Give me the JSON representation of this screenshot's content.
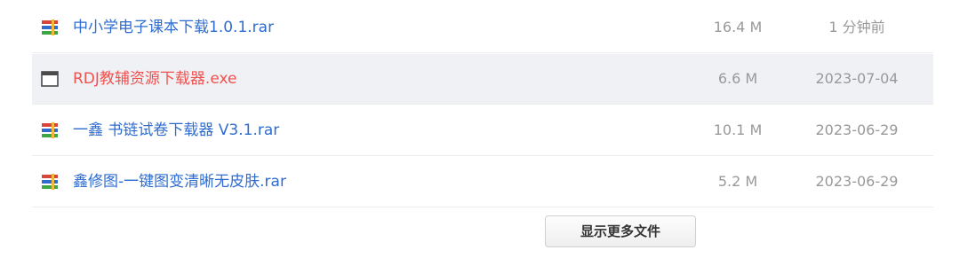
{
  "files": [
    {
      "name": "中小学电子课本下载1.0.1.rar",
      "size": "16.4 M",
      "date": "1 分钟前",
      "icon": "rar-archive-icon"
    },
    {
      "name": "RDJ教辅资源下载器.exe",
      "size": "6.6 M",
      "date": "2023-07-04",
      "icon": "exe-window-icon"
    },
    {
      "name": "一鑫 书链试卷下载器 V3.1.rar",
      "size": "10.1 M",
      "date": "2023-06-29",
      "icon": "rar-archive-icon"
    },
    {
      "name": "鑫修图-一键图变清晰无皮肤.rar",
      "size": "5.2 M",
      "date": "2023-06-29",
      "icon": "rar-archive-icon"
    }
  ],
  "show_more_label": "显示更多文件",
  "colors": {
    "link": "#2f6ccf",
    "link_hover": "#f0524f",
    "meta_text": "#999999",
    "hover_row_bg": "#eff1f5"
  }
}
